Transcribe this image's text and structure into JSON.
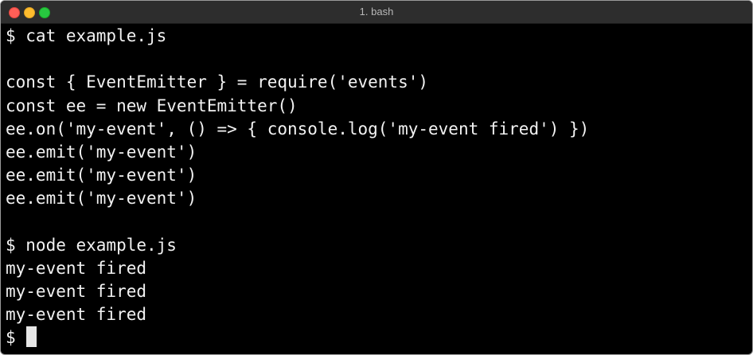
{
  "window": {
    "title": "1. bash"
  },
  "terminal": {
    "lines": [
      "$ cat example.js",
      "",
      "const { EventEmitter } = require('events')",
      "const ee = new EventEmitter()",
      "ee.on('my-event', () => { console.log('my-event fired') })",
      "ee.emit('my-event')",
      "ee.emit('my-event')",
      "ee.emit('my-event')",
      "",
      "$ node example.js",
      "my-event fired",
      "my-event fired",
      "my-event fired"
    ],
    "prompt": "$ "
  },
  "colors": {
    "background": "#000000",
    "text": "#f2f2f2",
    "titlebar": "#2d2d2d",
    "close": "#ff5f57",
    "minimize": "#febc2e",
    "zoom": "#28c840"
  }
}
